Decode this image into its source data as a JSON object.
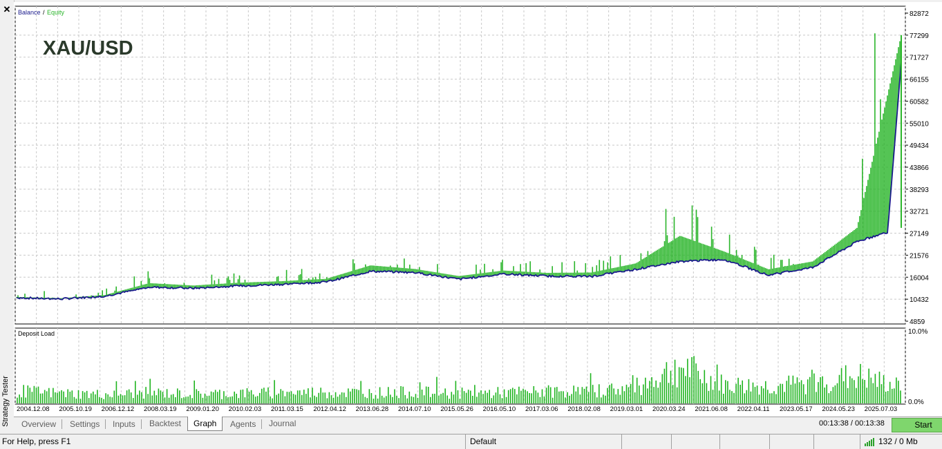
{
  "window": {
    "close_icon": "close-icon",
    "panel_title": "Strategy Tester"
  },
  "top_chart": {
    "legend_balance": "Balance",
    "legend_sep": " / ",
    "legend_equity": "Equity",
    "symbol_label": "XAU/USD",
    "y_ticks": [
      "82872",
      "77299",
      "71727",
      "66155",
      "60582",
      "55010",
      "49434",
      "43866",
      "38293",
      "32721",
      "27149",
      "21576",
      "16004",
      "10432",
      "4859"
    ],
    "x_ticks": [
      "2004.12.08",
      "2005.10.19",
      "2006.12.12",
      "2008.03.19",
      "2009.01.20",
      "2010.02.03",
      "2011.03.15",
      "2012.04.12",
      "2013.06.28",
      "2014.07.10",
      "2015.05.26",
      "2016.05.10",
      "2017.03.06",
      "2018.02.08",
      "2019.03.01",
      "2020.03.24",
      "2021.06.08",
      "2022.04.11",
      "2023.05.17",
      "2024.05.23",
      "2025.07.03"
    ],
    "colors": {
      "balance": "#1a1a8c",
      "equity": "#2ab52a",
      "grid": "#c8c8c8"
    }
  },
  "bottom_chart": {
    "title": "Deposit Load",
    "y_ticks": [
      "10.0%",
      "0.0%"
    ],
    "colors": {
      "bars": "#1fb41f"
    }
  },
  "chart_data": [
    {
      "type": "line",
      "title": "",
      "legend": [
        "Balance",
        "Equity"
      ],
      "ylim": [
        4859,
        82872
      ],
      "x": [
        "2004.12.08",
        "2005.10.19",
        "2006.12.12",
        "2008.03.19",
        "2009.01.20",
        "2010.02.03",
        "2011.03.15",
        "2012.04.12",
        "2013.06.28",
        "2014.07.10",
        "2015.05.26",
        "2016.05.10",
        "2017.03.06",
        "2018.02.08",
        "2019.03.01",
        "2020.03.24",
        "2021.06.08",
        "2022.04.11",
        "2023.05.17",
        "2024.05.23",
        "2025.07.03"
      ],
      "series": [
        {
          "name": "Balance",
          "values": [
            10800,
            10500,
            11200,
            13500,
            13200,
            13800,
            14200,
            14800,
            17500,
            17200,
            15500,
            16800,
            16300,
            16200,
            18000,
            20000,
            20500,
            16500,
            18500,
            25000,
            28500
          ]
        },
        {
          "name": "Equity",
          "values": [
            11000,
            10700,
            11500,
            14500,
            13900,
            14600,
            15000,
            15600,
            19000,
            18100,
            16300,
            17700,
            17100,
            17200,
            19500,
            26500,
            22500,
            18000,
            20000,
            28500,
            77299
          ]
        }
      ],
      "grid": true,
      "legend_position": "top-left"
    },
    {
      "type": "bar",
      "title": "Deposit Load",
      "ylim": [
        0,
        10
      ],
      "x": [
        "2004.12.08",
        "2005.10.19",
        "2006.12.12",
        "2008.03.19",
        "2009.01.20",
        "2010.02.03",
        "2011.03.15",
        "2012.04.12",
        "2013.06.28",
        "2014.07.10",
        "2015.05.26",
        "2016.05.10",
        "2017.03.06",
        "2018.02.08",
        "2019.03.01",
        "2020.03.24",
        "2021.06.08",
        "2022.04.11",
        "2023.05.17",
        "2024.05.23",
        "2025.07.03"
      ],
      "values": [
        2.2,
        1.8,
        1.6,
        1.9,
        1.7,
        1.8,
        1.9,
        2.0,
        1.9,
        2.0,
        1.8,
        1.9,
        2.1,
        2.2,
        2.8,
        6.5,
        3.2,
        3.0,
        3.5,
        4.8,
        2.8
      ]
    }
  ],
  "tabs": [
    {
      "label": "Overview"
    },
    {
      "label": "Settings"
    },
    {
      "label": "Inputs"
    },
    {
      "label": "Backtest"
    },
    {
      "label": "Graph"
    },
    {
      "label": "Agents"
    },
    {
      "label": "Journal"
    }
  ],
  "active_tab": "Graph",
  "timer": "00:13:38 / 00:13:38",
  "start_label": "Start",
  "statusbar": {
    "help": "For Help, press F1",
    "profile": "Default",
    "network": "132 / 0 Mb"
  }
}
